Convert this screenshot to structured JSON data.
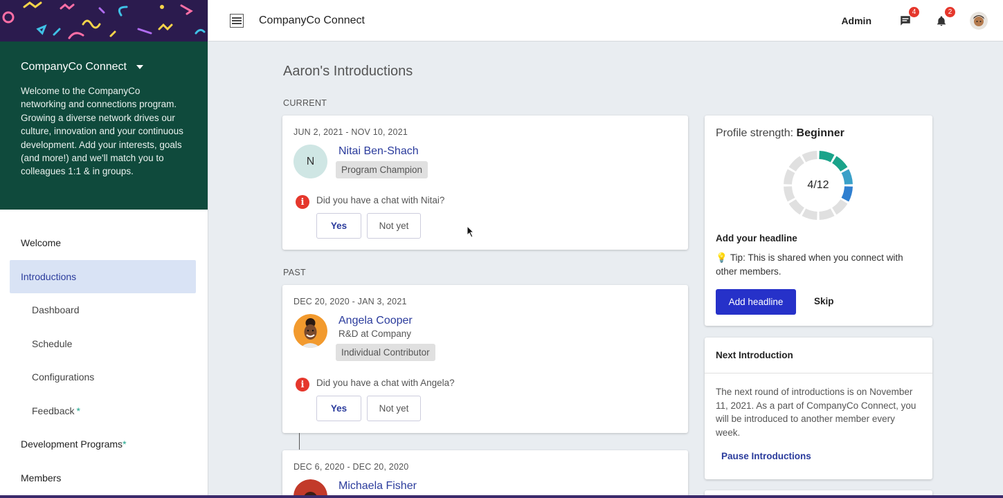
{
  "sidebar": {
    "program_title": "CompanyCo Connect",
    "program_description": "Welcome to the CompanyCo networking and connections program. Growing a diverse network drives our culture, innovation and your continuous development. Add your interests, goals (and more!) and we'll match you to colleagues 1:1 & in groups.",
    "nav": {
      "welcome": "Welcome",
      "introductions": "Introductions",
      "dashboard": "Dashboard",
      "schedule": "Schedule",
      "configurations": "Configurations",
      "feedback": "Feedback",
      "development_programs": "Development Programs",
      "members": "Members",
      "star": "*"
    }
  },
  "topbar": {
    "title": "CompanyCo Connect",
    "admin_label": "Admin",
    "messages_count": "4",
    "notifications_count": "2"
  },
  "main": {
    "page_title": "Aaron's Introductions",
    "current_label": "CURRENT",
    "past_label": "PAST",
    "yes_label": "Yes",
    "not_yet_label": "Not yet",
    "current": {
      "date": "JUN 2, 2021 - NOV 10, 2021",
      "initial": "N",
      "name": "Nitai Ben-Shach",
      "tag": "Program Champion",
      "question": "Did you have a chat with Nitai?"
    },
    "past": [
      {
        "date": "DEC 20, 2020 - JAN 3, 2021",
        "name": "Angela Cooper",
        "role": "R&D at Company",
        "tag": "Individual Contributor",
        "question": "Did you have a chat with Angela?"
      },
      {
        "date": "DEC 6, 2020 - DEC 20, 2020",
        "name": "Michaela Fisher"
      }
    ]
  },
  "profile": {
    "strength_label": "Profile strength:",
    "strength_value": "Beginner",
    "progress_text": "4/12",
    "progress_done": 4,
    "progress_total": 12,
    "headline_title": "Add your headline",
    "tip": "Tip: This is shared when you connect with other members.",
    "add_button": "Add headline",
    "skip_button": "Skip"
  },
  "next_intro": {
    "title": "Next Introduction",
    "body": "The next round of introductions is on November 11, 2021. As a part of CompanyCo Connect, you will be introduced to another member every week.",
    "pause_link": "Pause Introductions"
  },
  "colors": {
    "primary": "#2631c9",
    "link": "#2a3b9c",
    "sidebar_panel": "#0f4a3c",
    "badge": "#e5372c",
    "donut_done": [
      "#1aa38a",
      "#1aa38a",
      "#3aa0c8",
      "#2f7fd0"
    ],
    "donut_todo": "#e0e0e0"
  }
}
